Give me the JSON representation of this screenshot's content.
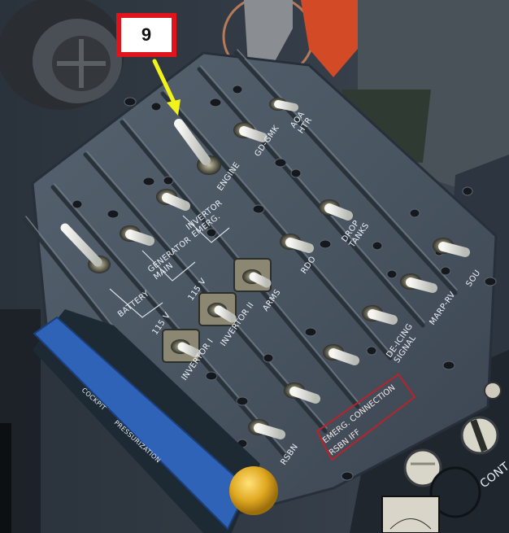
{
  "callout": {
    "number": "9"
  },
  "panel": {
    "labels": {
      "battery": "BATTERY",
      "generator_main": "GENERATOR\nMAIN",
      "inverter_emerg": "INVERTOR\nEMERG.",
      "v115_a": "115 V",
      "v115_b": "115 V",
      "inverter_1": "INVERTOR I",
      "inverter_2": "INVERTOR II",
      "engine": "ENGINE",
      "gd_gmk": "GD-GMK",
      "aoa_htr": "AOA\nHTR",
      "drop_tanks": "DROP\nTANKS",
      "rdo": "RDO",
      "arms": "ARMS",
      "sou": "SOU",
      "marp_rv": "MARP-RV",
      "de_icing_signal": "DE-ICING\nSIGNAL",
      "rsbn": "RSBN",
      "emerg_connection": "EMERG. CONNECTION",
      "rsbn_iff": "RSBN      IFF"
    }
  },
  "placard": {
    "text_a": "COCKPIT",
    "text_b": "PRESSURIZATION"
  },
  "right_panel": {
    "label": "CONT"
  },
  "colors": {
    "panel": "#44505e",
    "callout_border": "#e0141c",
    "arrow": "#f2f21a",
    "placard": "#2f63b8",
    "knob": "#e0a820",
    "red_outline": "#b8232a"
  }
}
